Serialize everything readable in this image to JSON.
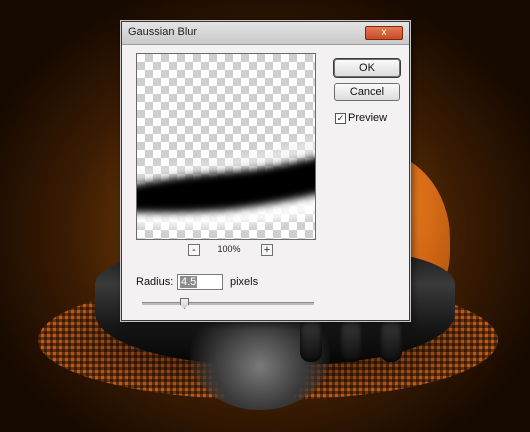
{
  "dialog": {
    "title": "Gaussian Blur",
    "close_label": "x",
    "ok_label": "OK",
    "cancel_label": "Cancel",
    "preview_label": "Preview",
    "preview_checked": true,
    "preview_check_glyph": "✓",
    "zoom_minus_label": "-",
    "zoom_plus_label": "+",
    "zoom_level": "100%",
    "radius_label": "Radius:",
    "radius_value": "4.5",
    "radius_unit": "pixels"
  },
  "colors": {
    "close_button": "#d4582e",
    "accent_orange": "#e0731a"
  }
}
